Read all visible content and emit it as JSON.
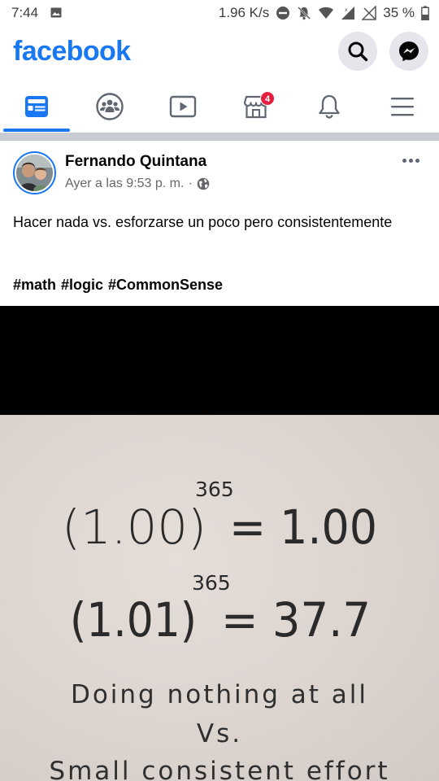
{
  "status_bar": {
    "time": "7:44",
    "speed": "1.96 K/s",
    "battery": "35 %"
  },
  "header": {
    "logo": "facebook",
    "brand_color": "#1877f2"
  },
  "tabs": [
    {
      "name": "news-feed",
      "icon": "news-feed-icon",
      "active": true
    },
    {
      "name": "groups",
      "icon": "groups-icon",
      "active": false
    },
    {
      "name": "watch",
      "icon": "watch-icon",
      "active": false
    },
    {
      "name": "marketplace",
      "icon": "marketplace-icon",
      "active": false,
      "badge": "4"
    },
    {
      "name": "notifications",
      "icon": "bell-icon",
      "active": false
    },
    {
      "name": "menu",
      "icon": "hamburger-icon",
      "active": false
    }
  ],
  "post": {
    "author": "Fernando Quintana",
    "timestamp": "Ayer a las 9:53 p. m.",
    "separator": "·",
    "privacy_icon": "globe-icon",
    "text": "Hacer nada vs. esforzarse un poco pero consistentemente",
    "hashtags": [
      "#math",
      "#logic",
      "#CommonSense"
    ],
    "image": {
      "eq1_base": "(1.00)",
      "eq1_exp": "365",
      "eq1_result": "= 1.00",
      "eq2_base": "(1.01)",
      "eq2_exp": "365",
      "eq2_result": "= 37.7",
      "caption_1": "Doing nothing at all",
      "caption_2": "Vs.",
      "caption_3": "Small consistent effort"
    }
  }
}
